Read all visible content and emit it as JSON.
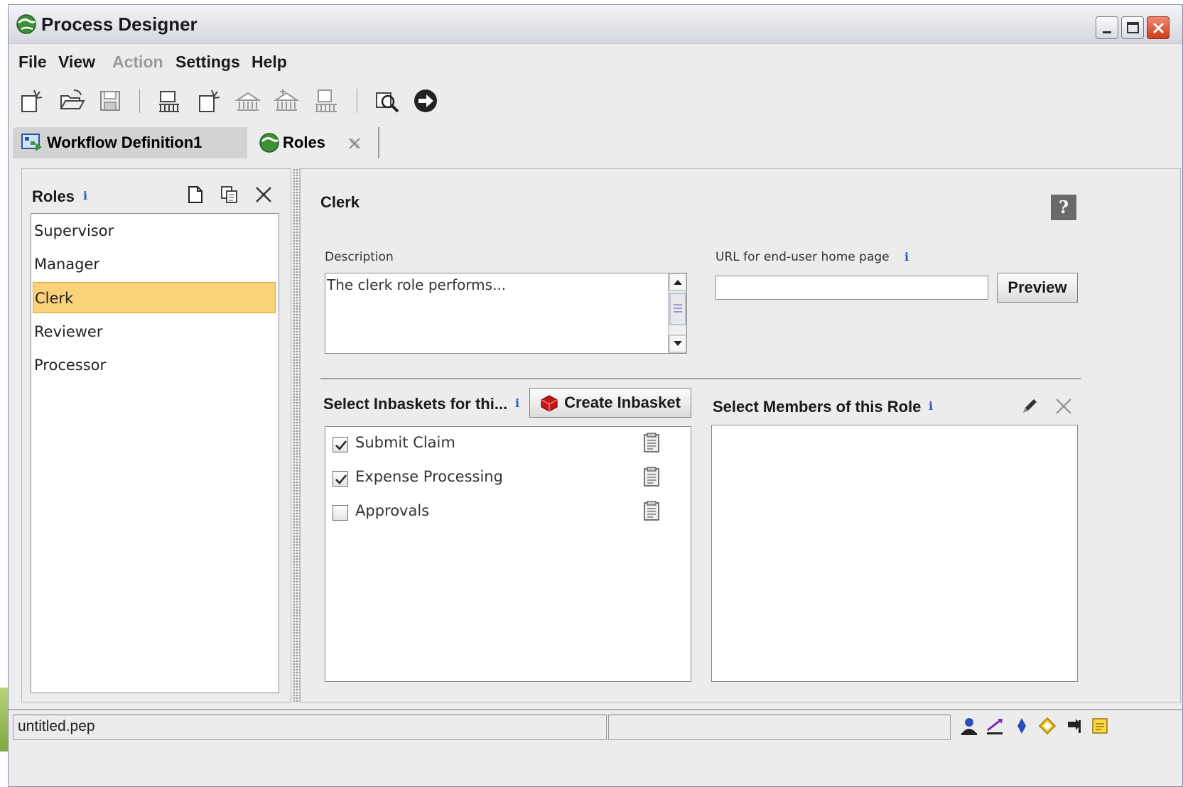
{
  "window": {
    "title": "Process Designer"
  },
  "menu": {
    "items": [
      {
        "label": "File",
        "enabled": true
      },
      {
        "label": "View",
        "enabled": true
      },
      {
        "label": "Action",
        "enabled": false
      },
      {
        "label": "Settings",
        "enabled": true
      },
      {
        "label": "Help",
        "enabled": true
      }
    ]
  },
  "toolbar": {
    "icons": [
      "new-workflow-icon",
      "open-folder-icon",
      "save-icon",
      "new-workspace-icon",
      "new-item-icon",
      "region-icon",
      "region-add-icon",
      "roster-icon",
      "search-find-icon",
      "run-arrow-icon"
    ]
  },
  "tabs": [
    {
      "label": "Workflow Definition1",
      "active": false
    },
    {
      "label": "Roles",
      "active": true,
      "closable": true
    }
  ],
  "roles_panel": {
    "title": "Roles",
    "items": [
      "Supervisor",
      "Manager",
      "Clerk",
      "Reviewer",
      "Processor"
    ],
    "selected": "Clerk"
  },
  "detail": {
    "role_name": "Clerk",
    "help_label": "?",
    "description_label": "Description",
    "description_value": "The clerk role performs...",
    "url_label": "URL for end-user home page",
    "url_value": "",
    "preview_label": "Preview",
    "inbaskets_title": "Select Inbaskets for thi...",
    "create_inbasket_label": "Create Inbasket",
    "inbaskets": [
      {
        "label": "Submit Claim",
        "checked": true
      },
      {
        "label": "Expense Processing",
        "checked": true
      },
      {
        "label": "Approvals",
        "checked": false
      }
    ],
    "members_title": "Select Members of this Role",
    "members": []
  },
  "statusbar": {
    "file": "untitled.pep",
    "middle": ""
  },
  "colors": {
    "selection": "#fbd27a",
    "selection_border": "#d9a23c",
    "info": "#2d56c0",
    "close_button": "#cc3c1c"
  }
}
